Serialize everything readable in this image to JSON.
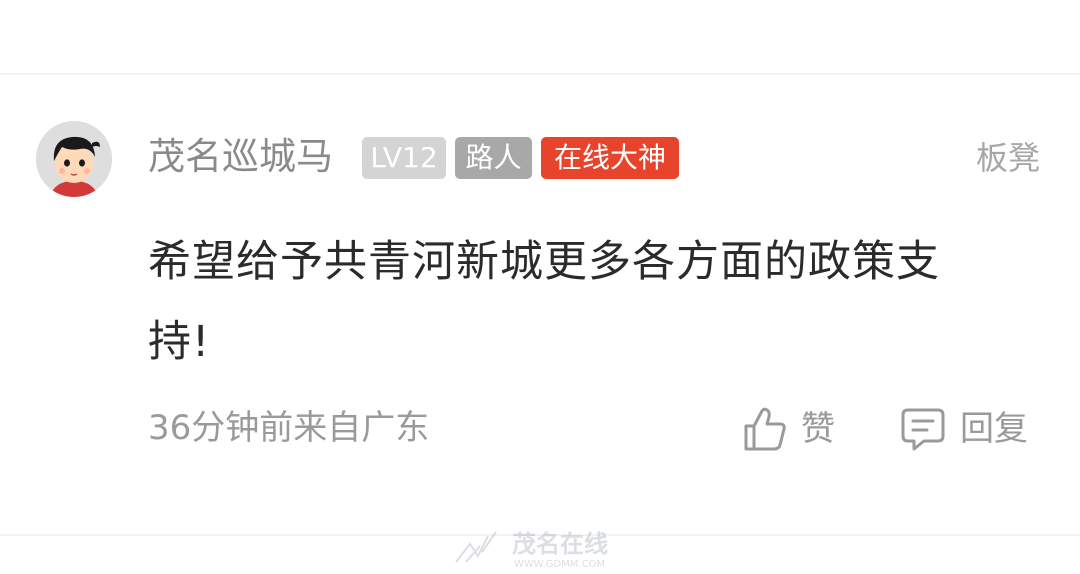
{
  "comment": {
    "user": {
      "name": "茂名巡城马",
      "level_badge": "LV12",
      "role_badge": "路人",
      "honor_badge": "在线大神"
    },
    "floor_label": "板凳",
    "text": "希望给予共青河新城更多各方面的政策支持!",
    "meta": "36分钟前来自广东",
    "actions": {
      "like_label": "赞",
      "reply_label": "回复"
    }
  },
  "watermark": {
    "brand": "茂名在线",
    "url": "WWW.GDMM.COM"
  },
  "colors": {
    "honor_badge": "#e8432b",
    "level_badge": "#d4d4d4",
    "role_badge": "#a8a8a8",
    "body_text": "#2b2b2b",
    "secondary_text": "#9a9a9a"
  },
  "icons": {
    "like": "thumbs-up-icon",
    "reply": "comment-bubble-icon"
  }
}
